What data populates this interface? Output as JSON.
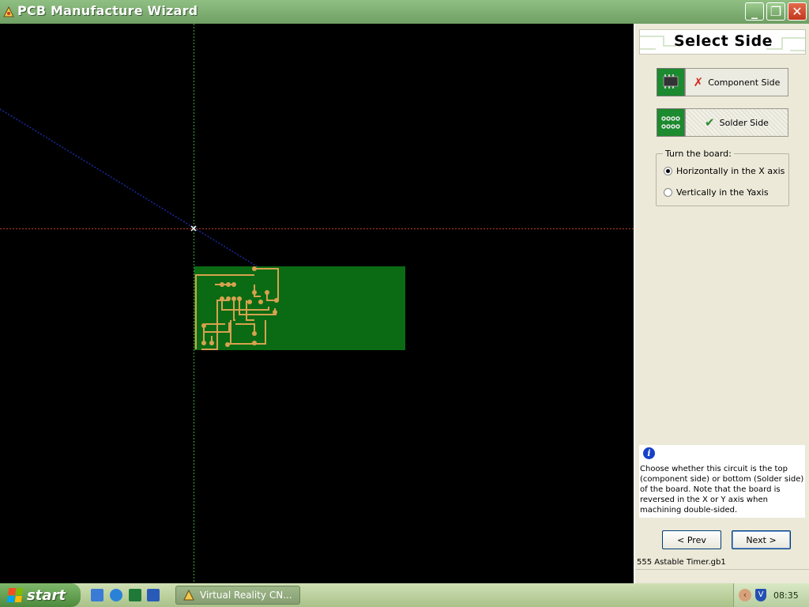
{
  "window": {
    "title": "PCB Manufacture Wizard",
    "controls": {
      "minimize": "_",
      "maximize": "❐",
      "close": "✕"
    }
  },
  "panel": {
    "title": "Select Side",
    "component_side": {
      "label": "Component Side",
      "mark": "✗",
      "mark_color": "#d42a1a"
    },
    "solder_side": {
      "label": "Solder Side",
      "mark": "✔",
      "mark_color": "#2e8b2e",
      "selected": true
    },
    "turn_group": {
      "legend": "Turn the board:",
      "options": [
        {
          "label": "Horizontally in the X axis",
          "checked": true
        },
        {
          "label": "Vertically in the Yaxis",
          "checked": false
        }
      ]
    },
    "info": {
      "icon": "i",
      "text": "Choose whether this circuit is the top (component side) or bottom (Solder side) of the board. Note that the board is reversed in the X or Y axis when machining double-sided."
    },
    "prev_label": "< Prev",
    "next_label": "Next >",
    "file_name": "555 Astable Timer.gb1"
  },
  "taskbar": {
    "start_label": "start",
    "task_item": "Virtual Reality CN...",
    "clock": "08:35",
    "tray_chevron": "‹",
    "tray_shield": "V"
  },
  "colors": {
    "board_green": "#0b6b14",
    "trace_copper": "#d7a24e",
    "axis_x": "#c0392b",
    "axis_y": "#3aa83a",
    "tool_path": "#1a2aa0"
  }
}
